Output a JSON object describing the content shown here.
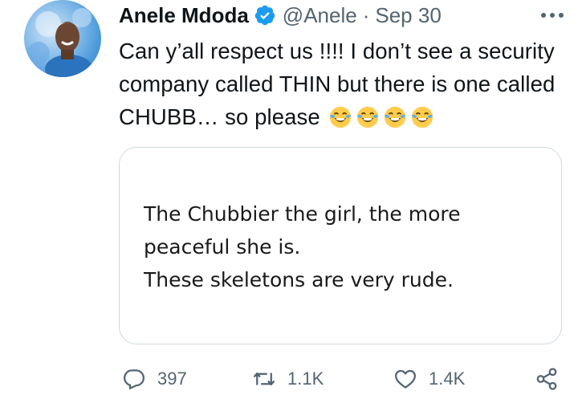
{
  "tweet": {
    "author_name": "Anele Mdoda",
    "handle": "@Anele",
    "separator": "·",
    "date": "Sep 30",
    "text": "Can y’all respect us !!!! I don’t see a security company called THIN but there is one called CHUBB… so please",
    "emojis": [
      "face-with-tears-of-joy",
      "face-with-tears-of-joy",
      "face-with-tears-of-joy",
      "face-with-tears-of-joy"
    ]
  },
  "card": {
    "lines": [
      "The Chubbier the girl, the more",
      "peaceful she is.",
      "These skeletons are very rude."
    ]
  },
  "actions": {
    "replies": "397",
    "retweets": "1.1K",
    "likes": "1.4K"
  },
  "icons": {
    "verified": "verified-badge-icon",
    "more": "more-icon",
    "reply": "reply-icon",
    "retweet": "retweet-icon",
    "like": "heart-icon",
    "share": "share-icon"
  },
  "colors": {
    "verified": "#1d9bf0",
    "secondary_text": "#536471",
    "border": "#cfd9de"
  }
}
